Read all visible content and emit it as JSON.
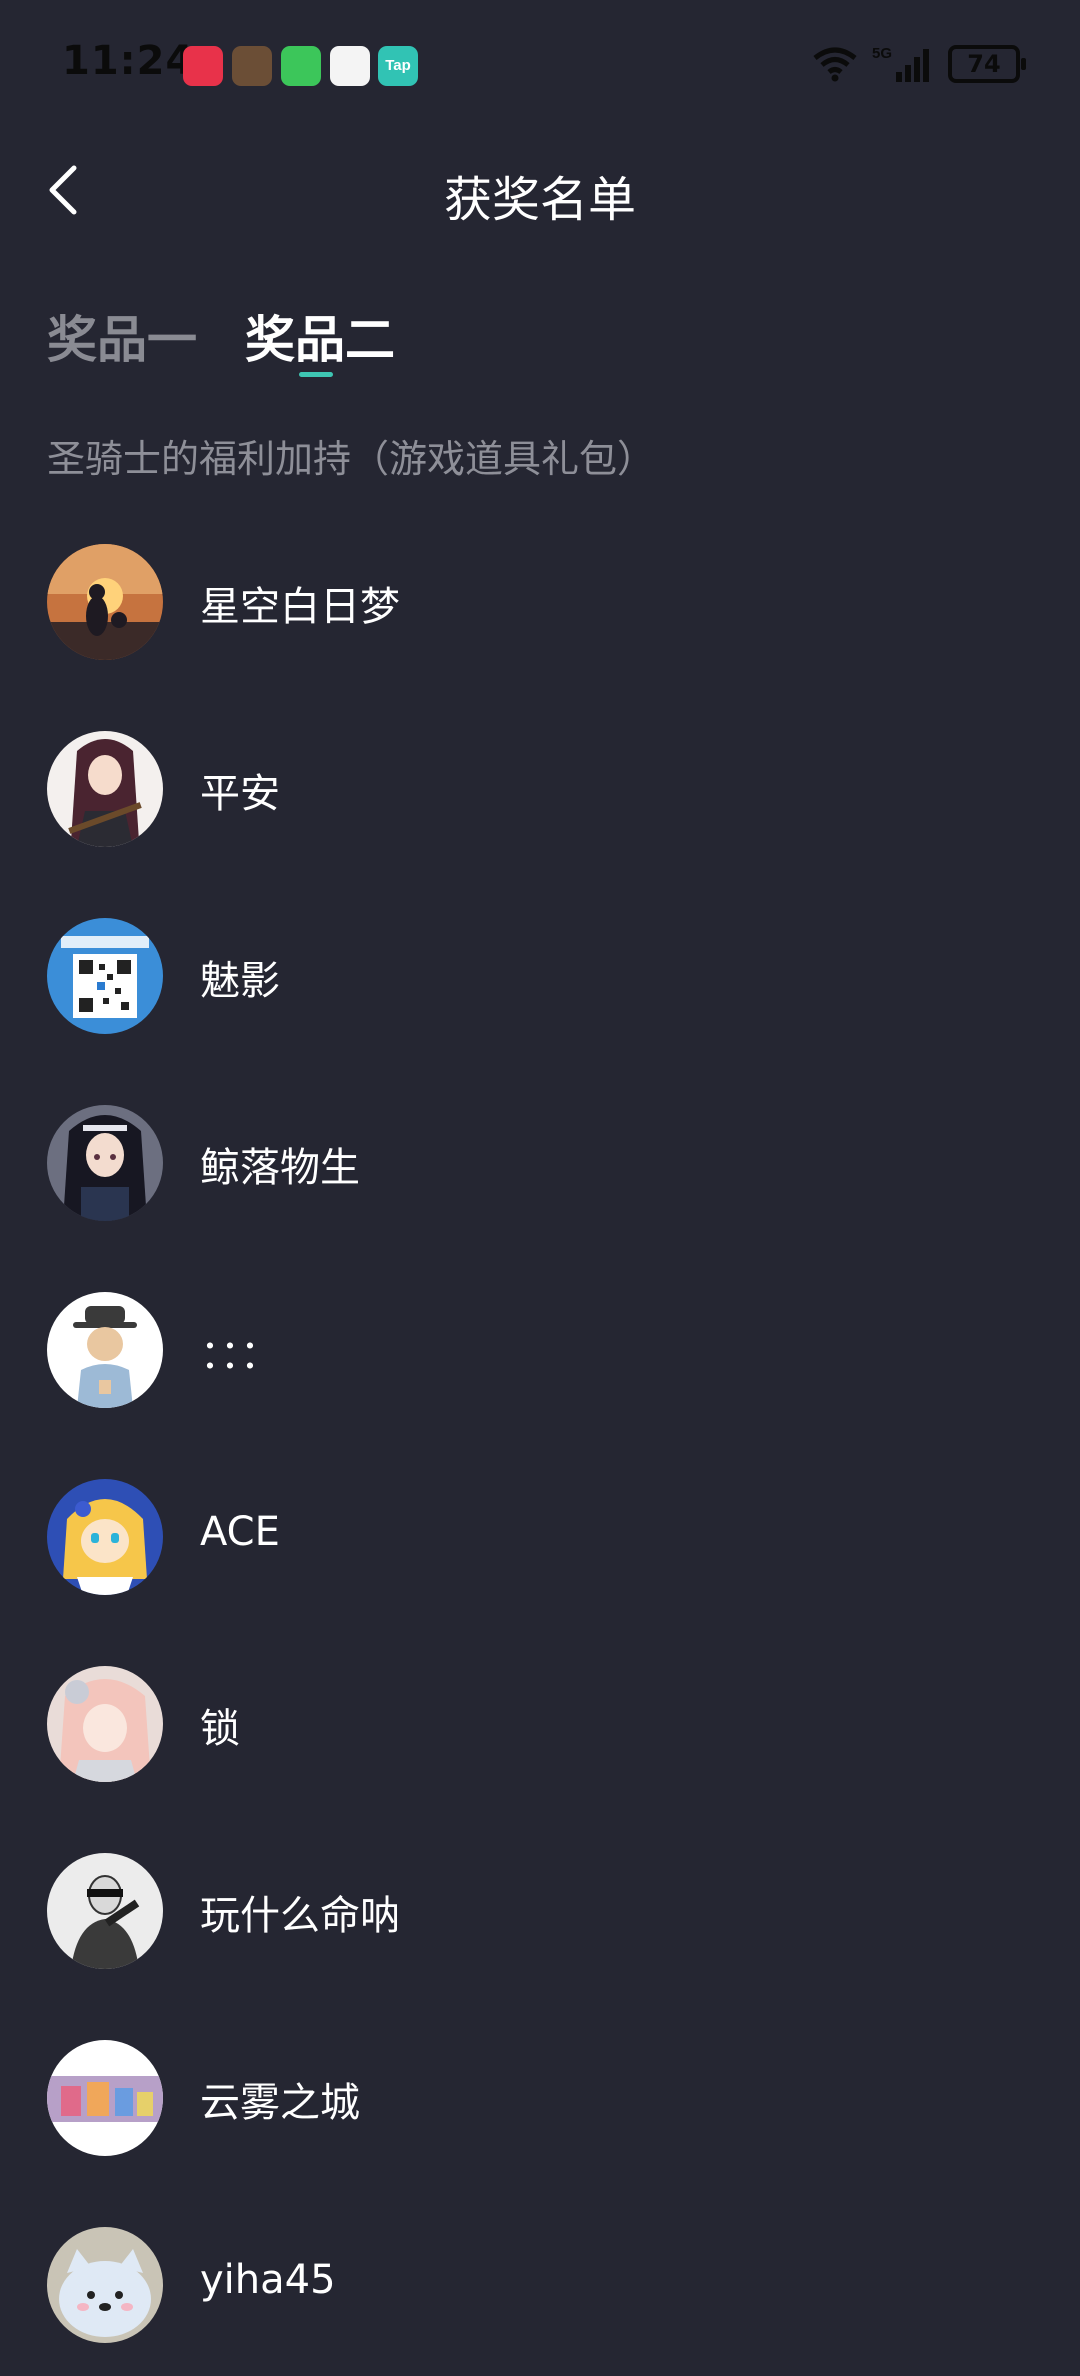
{
  "status_bar": {
    "time": "11:24",
    "battery": "74",
    "tap_app_label": "Tap"
  },
  "header": {
    "title": "获奖名单"
  },
  "tabs": [
    {
      "label": "奖品一",
      "selected": false
    },
    {
      "label": "奖品二",
      "selected": true
    }
  ],
  "prize_description": "圣骑士的福利加持（游戏道具礼包）",
  "winners": [
    {
      "name": "星空白日梦"
    },
    {
      "name": "平安"
    },
    {
      "name": "魅影"
    },
    {
      "name": "鲸落物生"
    },
    {
      "name": "：：："
    },
    {
      "name": "ACE"
    },
    {
      "name": "锁"
    },
    {
      "name": "玩什么命呐"
    },
    {
      "name": "云雾之城"
    },
    {
      "name": "yiha45"
    }
  ],
  "colors": {
    "background": "#252632",
    "accent": "#3ec6b3",
    "text_primary": "#ffffff",
    "text_secondary": "#8e8f98"
  }
}
